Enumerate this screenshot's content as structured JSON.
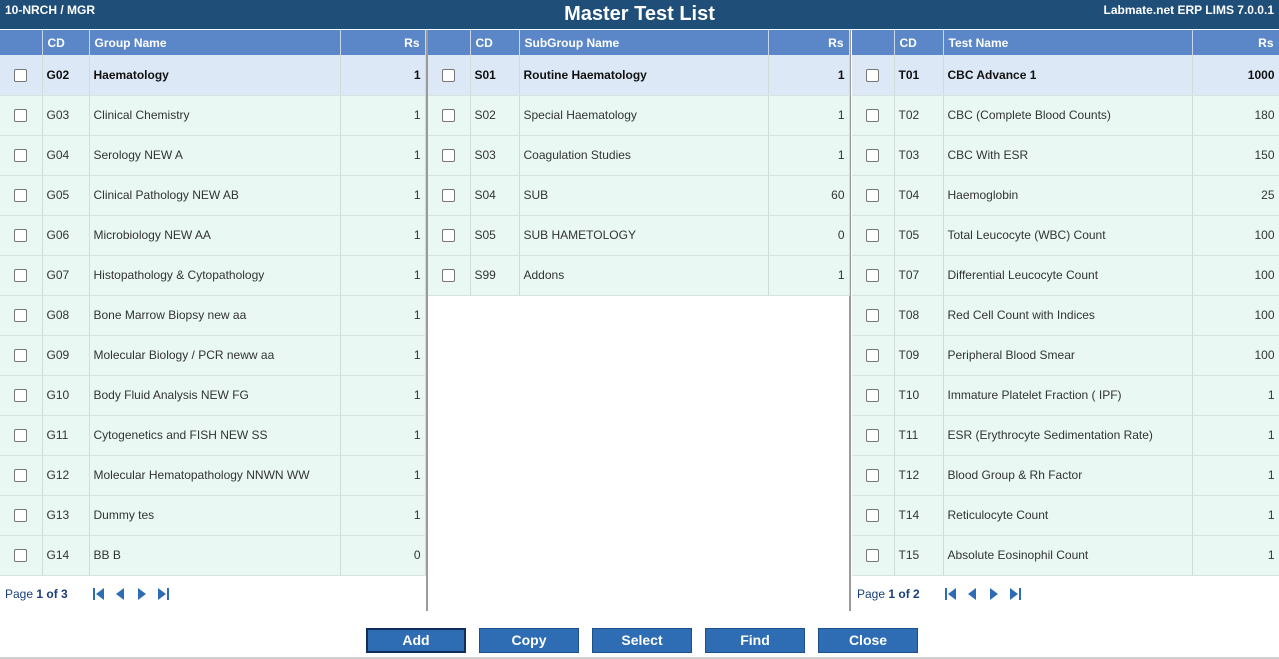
{
  "header": {
    "left": "10-NRCH / MGR",
    "title": "Master Test List",
    "right": "Labmate.net ERP LIMS 7.0.0.1"
  },
  "groups": {
    "columns": {
      "cd": "CD",
      "name": "Group Name",
      "rs": "Rs"
    },
    "rows": [
      {
        "cd": "G02",
        "name": "Haematology",
        "rs": "1",
        "selected": true
      },
      {
        "cd": "G03",
        "name": "Clinical Chemistry",
        "rs": "1"
      },
      {
        "cd": "G04",
        "name": "Serology NEW A",
        "rs": "1"
      },
      {
        "cd": "G05",
        "name": "Clinical Pathology NEW AB",
        "rs": "1"
      },
      {
        "cd": "G06",
        "name": "Microbiology NEW AA",
        "rs": "1"
      },
      {
        "cd": "G07",
        "name": "Histopathology & Cytopathology",
        "rs": "1"
      },
      {
        "cd": "G08",
        "name": "Bone Marrow Biopsy new aa",
        "rs": "1"
      },
      {
        "cd": "G09",
        "name": "Molecular Biology / PCR neww aa",
        "rs": "1"
      },
      {
        "cd": "G10",
        "name": "Body Fluid Analysis NEW FG",
        "rs": "1"
      },
      {
        "cd": "G11",
        "name": "Cytogenetics and FISH NEW SS",
        "rs": "1"
      },
      {
        "cd": "G12",
        "name": "Molecular Hematopathology NNWN WW",
        "rs": "1"
      },
      {
        "cd": "G13",
        "name": "Dummy tes",
        "rs": "1"
      },
      {
        "cd": "G14",
        "name": "BB B",
        "rs": "0"
      }
    ],
    "pager": {
      "prefix": "Page ",
      "current": "1",
      "of": " of ",
      "total": "3"
    }
  },
  "subgroups": {
    "columns": {
      "cd": "CD",
      "name": "SubGroup Name",
      "rs": "Rs"
    },
    "rows": [
      {
        "cd": "S01",
        "name": "Routine Haematology",
        "rs": "1",
        "selected": true
      },
      {
        "cd": "S02",
        "name": "Special Haematology",
        "rs": "1"
      },
      {
        "cd": "S03",
        "name": "Coagulation Studies",
        "rs": "1"
      },
      {
        "cd": "S04",
        "name": "SUB",
        "rs": "60"
      },
      {
        "cd": "S05",
        "name": "SUB HAMETOLOGY",
        "rs": "0"
      },
      {
        "cd": "S99",
        "name": "Addons",
        "rs": "1"
      }
    ]
  },
  "tests": {
    "columns": {
      "cd": "CD",
      "name": "Test Name",
      "rs": "Rs"
    },
    "rows": [
      {
        "cd": "T01",
        "name": "CBC Advance 1",
        "rs": "1000",
        "selected": true
      },
      {
        "cd": "T02",
        "name": "CBC (Complete Blood Counts)",
        "rs": "180"
      },
      {
        "cd": "T03",
        "name": "CBC With ESR",
        "rs": "150"
      },
      {
        "cd": "T04",
        "name": "Haemoglobin",
        "rs": "25"
      },
      {
        "cd": "T05",
        "name": "Total Leucocyte (WBC) Count",
        "rs": "100"
      },
      {
        "cd": "T07",
        "name": "Differential Leucocyte Count",
        "rs": "100"
      },
      {
        "cd": "T08",
        "name": "Red Cell Count with Indices",
        "rs": "100"
      },
      {
        "cd": "T09",
        "name": "Peripheral Blood Smear",
        "rs": "100"
      },
      {
        "cd": "T10",
        "name": "Immature Platelet Fraction ( IPF)",
        "rs": "1"
      },
      {
        "cd": "T11",
        "name": "ESR (Erythrocyte Sedimentation Rate)",
        "rs": "1"
      },
      {
        "cd": "T12",
        "name": "Blood Group & Rh Factor",
        "rs": "1"
      },
      {
        "cd": "T14",
        "name": "Reticulocyte Count",
        "rs": "1"
      },
      {
        "cd": "T15",
        "name": "Absolute Eosinophil Count",
        "rs": "1"
      }
    ],
    "pager": {
      "prefix": "Page ",
      "current": "1",
      "of": " of ",
      "total": "2"
    }
  },
  "actions": {
    "add": "Add",
    "copy": "Copy",
    "select": "Select",
    "find": "Find",
    "close": "Close"
  },
  "icons": {
    "first": "first-page-icon",
    "prev": "prev-page-icon",
    "next": "next-page-icon",
    "last": "last-page-icon"
  },
  "colors": {
    "header": "#1f4e79",
    "column_header": "#5b87c9",
    "row": "#e9f8f3",
    "selected_row": "#dce8f5",
    "button": "#2e6db4"
  }
}
